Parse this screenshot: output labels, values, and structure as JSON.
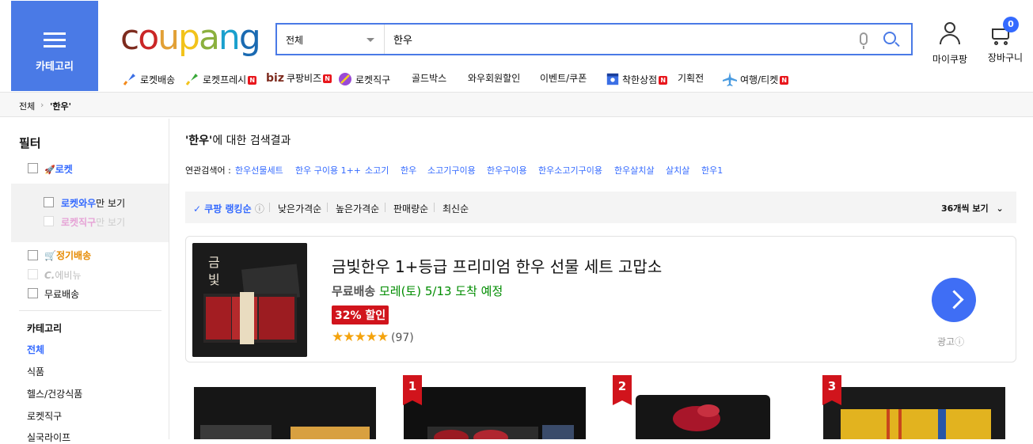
{
  "header": {
    "category_label": "카테고리",
    "logo": {
      "c": "c",
      "o": "o",
      "u": "u",
      "p": "p",
      "a": "a",
      "n": "n",
      "g": "g"
    },
    "logo_colors": [
      "#7d2b1e",
      "#ca2627",
      "#e2a036",
      "#f2c31b",
      "#8bb03e",
      "#1aa0cd",
      "#1a6ab2"
    ],
    "search": {
      "category": "전체",
      "query": "한우"
    },
    "my_coupang": "마이쿠팡",
    "cart": {
      "label": "장바구니",
      "count": "0"
    }
  },
  "nav": [
    {
      "label": "로켓배송",
      "icon": "rocket-icon",
      "badge": ""
    },
    {
      "label": "로켓프레시",
      "icon": "rocket-fresh-icon",
      "badge": "N"
    },
    {
      "label": "쿠팡비즈",
      "icon": "biz-icon",
      "badge": "N",
      "prefix": "biz"
    },
    {
      "label": "로켓직구",
      "icon": "globe-rocket-icon",
      "badge": ""
    },
    {
      "label": "골드박스",
      "icon": "",
      "badge": ""
    },
    {
      "label": "와우회원할인",
      "icon": "",
      "badge": ""
    },
    {
      "label": "이벤트/쿠폰",
      "icon": "",
      "badge": ""
    },
    {
      "label": "착한상점",
      "icon": "shop-icon",
      "badge": "N"
    },
    {
      "label": "기획전",
      "icon": "",
      "badge": ""
    },
    {
      "label": "여행/티켓",
      "icon": "airplane-icon",
      "badge": "N"
    }
  ],
  "breadcrumb": {
    "root": "전체",
    "current": "'한우'"
  },
  "sidebar": {
    "title": "필터",
    "rocket": "로켓",
    "rocket_wow": "로켓와우",
    "rocket_wow_suffix": "만 보기",
    "rocket_jikgu": "로켓직구",
    "rocket_jikgu_suffix": "만 보기",
    "regular": "정기배송",
    "evinew": "에비뉴",
    "free_shipping": "무료배송",
    "category_title": "카테고리",
    "categories": [
      "전체",
      "식품",
      "헬스/건강식품",
      "로켓직구",
      "실국라이프"
    ]
  },
  "results": {
    "query": "'한우'",
    "suffix": "에 대한 검색결과",
    "related_label": "연관검색어 :",
    "related": [
      "한우선물세트",
      "한우 구이용 1++",
      "소고기",
      "한우",
      "소고기구이용",
      "한우구이용",
      "한우소고기구이용",
      "한우살치살",
      "살치살",
      "한우1"
    ]
  },
  "sort": {
    "options": [
      "쿠팡 랭킹순",
      "낮은가격순",
      "높은가격순",
      "판매량순",
      "최신순"
    ],
    "per_page": "36개씩 보기"
  },
  "ad": {
    "title": "금빛한우 1+등급 프리미엄 한우 선물 세트 고맙소",
    "free_shipping": "무료배송",
    "arrival": "모레(토) 5/13 도착 예정",
    "discount": "32% 할인",
    "stars": "★★★★★",
    "reviews": "(97)",
    "ad_label": "광고",
    "rating": 5
  },
  "products": [
    {
      "rank": ""
    },
    {
      "rank": "1"
    },
    {
      "rank": "2"
    },
    {
      "rank": "3"
    }
  ],
  "colors": {
    "accent": "#346aff",
    "category_btn": "#4a7ae6",
    "discount": "#d1141c",
    "arrival": "#008c00"
  }
}
